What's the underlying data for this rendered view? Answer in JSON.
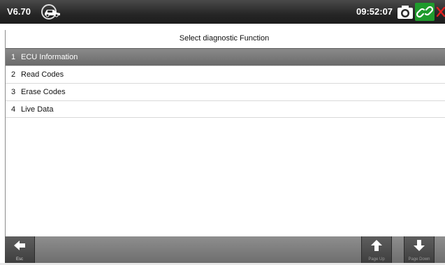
{
  "header": {
    "version": "V6.70",
    "time": "09:52:07",
    "logo_icon": "car-logo-icon",
    "camera_icon": "camera-icon",
    "link_icon": "link-icon",
    "close_icon": "close-icon",
    "colors": {
      "link_bg": "#1f9b2c",
      "close": "#e02020"
    }
  },
  "main": {
    "title": "Select diagnostic Function",
    "items": [
      {
        "num": "1",
        "label": "ECU Information",
        "selected": true
      },
      {
        "num": "2",
        "label": "Read Codes",
        "selected": false
      },
      {
        "num": "3",
        "label": "Erase Codes",
        "selected": false
      },
      {
        "num": "4",
        "label": "Live Data",
        "selected": false
      }
    ]
  },
  "footer": {
    "esc_label": "Esc",
    "page_up_label": "Page Up",
    "page_down_label": "Page Down"
  }
}
